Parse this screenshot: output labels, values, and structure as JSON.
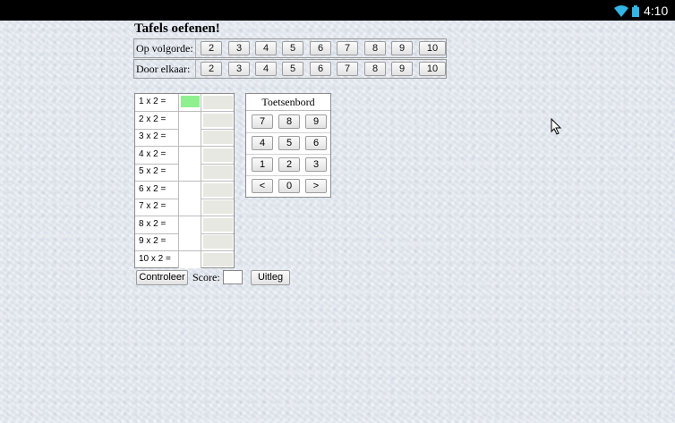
{
  "statusbar": {
    "time": "4:10",
    "icons": [
      "wifi-icon",
      "battery-icon"
    ]
  },
  "title": "Tafels oefenen!",
  "rows": [
    {
      "label": "Op volgorde:",
      "buttons": [
        "2",
        "3",
        "4",
        "5",
        "6",
        "7",
        "8",
        "9",
        "10"
      ]
    },
    {
      "label": "Door elkaar:",
      "buttons": [
        "2",
        "3",
        "4",
        "5",
        "6",
        "7",
        "8",
        "9",
        "10"
      ]
    }
  ],
  "exercises": [
    {
      "question": "1 x 2 =",
      "answer": "",
      "active": true
    },
    {
      "question": "2 x 2 =",
      "answer": ""
    },
    {
      "question": "3 x 2 =",
      "answer": ""
    },
    {
      "question": "4 x 2 =",
      "answer": ""
    },
    {
      "question": "5 x 2 =",
      "answer": ""
    },
    {
      "question": "6 x 2 =",
      "answer": ""
    },
    {
      "question": "7 x 2 =",
      "answer": ""
    },
    {
      "question": "8 x 2 =",
      "answer": ""
    },
    {
      "question": "9 x 2 =",
      "answer": ""
    },
    {
      "question": "10 x 2 =",
      "answer": ""
    }
  ],
  "keyboard": {
    "title": "Toetsenbord",
    "rows": [
      [
        "7",
        "8",
        "9"
      ],
      [
        "4",
        "5",
        "6"
      ],
      [
        "1",
        "2",
        "3"
      ],
      [
        "<",
        "0",
        ">"
      ]
    ]
  },
  "controls": {
    "check_label": "Controleer",
    "score_label": "Score:",
    "score_value": "",
    "explain_label": "Uitleg"
  },
  "colors": {
    "active_answer": "#8ff08f",
    "statusbar": "#000000"
  }
}
